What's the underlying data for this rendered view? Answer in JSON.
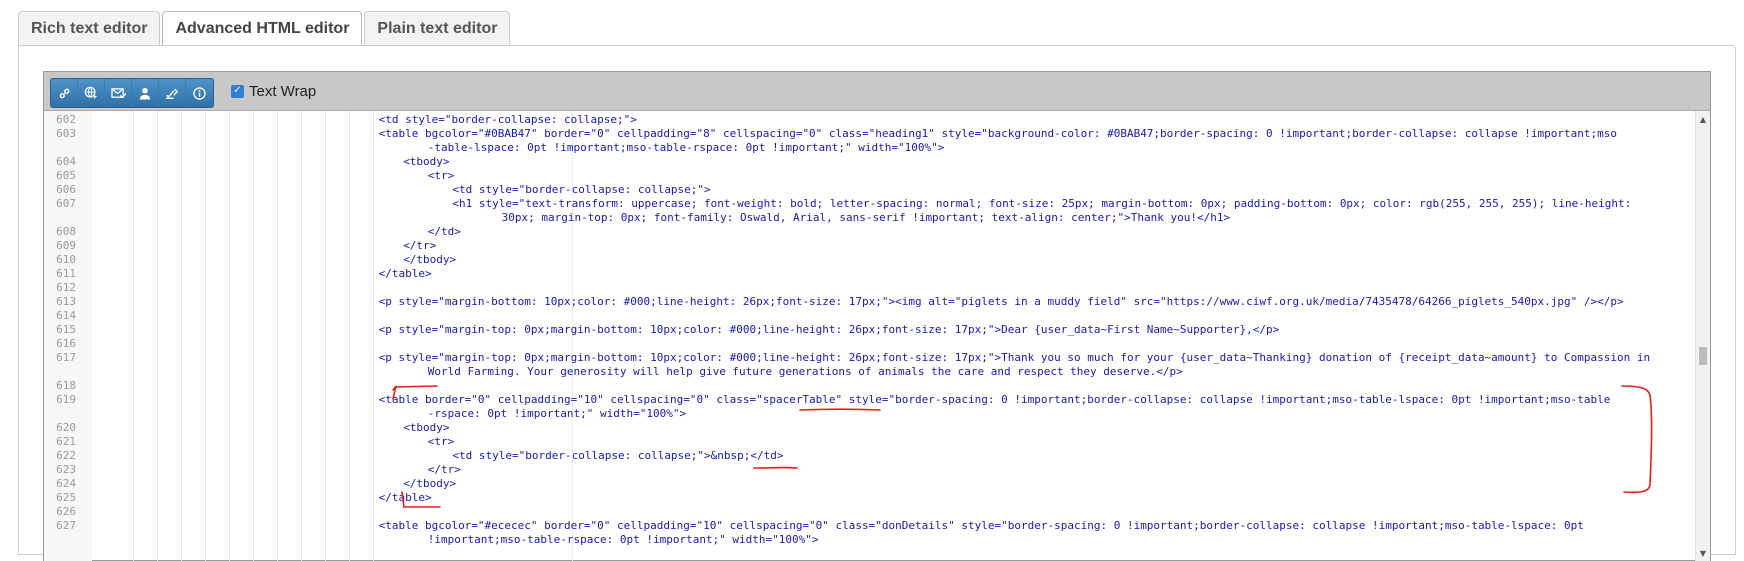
{
  "tabs": [
    {
      "label": "Rich text editor",
      "active": false
    },
    {
      "label": "Advanced HTML editor",
      "active": true
    },
    {
      "label": "Plain text editor",
      "active": false
    }
  ],
  "toolbar": {
    "buttons": [
      {
        "icon": "link-icon"
      },
      {
        "icon": "globe-icon"
      },
      {
        "icon": "envelope-icon"
      },
      {
        "icon": "user-icon"
      },
      {
        "icon": "checklist-icon"
      },
      {
        "icon": "info-icon"
      }
    ],
    "text_wrap_label": "Text Wrap",
    "text_wrap_checked": true
  },
  "code_lines": [
    {
      "n": "602",
      "indent": 11,
      "text": "<td style=\"border-collapse: collapse;\">"
    },
    {
      "n": "603",
      "indent": 11,
      "text": "<table bgcolor=\"#0BAB47\" border=\"0\" cellpadding=\"8\" cellspacing=\"0\" class=\"heading1\" style=\"background-color: #0BAB47;border-spacing: 0 !important;border-collapse: collapse !important;mso"
    },
    {
      "n": "",
      "indent": 13,
      "text": "-table-lspace: 0pt !important;mso-table-rspace: 0pt !important;\" width=\"100%\">"
    },
    {
      "n": "604",
      "indent": 12,
      "text": "<tbody>"
    },
    {
      "n": "605",
      "indent": 13,
      "text": "<tr>"
    },
    {
      "n": "606",
      "indent": 14,
      "text": "<td style=\"border-collapse: collapse;\">"
    },
    {
      "n": "607",
      "indent": 14,
      "text": "<h1 style=\"text-transform: uppercase; font-weight: bold; letter-spacing: normal; font-size: 25px; margin-bottom: 0px; padding-bottom: 0px; color: rgb(255, 255, 255); line-height:"
    },
    {
      "n": "",
      "indent": 16,
      "text": "30px; margin-top: 0px; font-family: Oswald, Arial, sans-serif !important; text-align: center;\">Thank you!</h1>"
    },
    {
      "n": "608",
      "indent": 13,
      "text": "</td>"
    },
    {
      "n": "609",
      "indent": 12,
      "text": "</tr>"
    },
    {
      "n": "610",
      "indent": 12,
      "text": "</tbody>"
    },
    {
      "n": "611",
      "indent": 11,
      "text": "</table>"
    },
    {
      "n": "612",
      "indent": 11,
      "text": ""
    },
    {
      "n": "613",
      "indent": 11,
      "text": "<p style=\"margin-bottom: 10px;color: #000;line-height: 26px;font-size: 17px;\"><img alt=\"piglets in a muddy field\" src=\"https://www.ciwf.org.uk/media/7435478/64266_piglets_540px.jpg\" /></p>"
    },
    {
      "n": "614",
      "indent": 11,
      "text": ""
    },
    {
      "n": "615",
      "indent": 11,
      "text": "<p style=\"margin-top: 0px;margin-bottom: 10px;color: #000;line-height: 26px;font-size: 17px;\">Dear {user_data~First Name~Supporter},</p>"
    },
    {
      "n": "616",
      "indent": 11,
      "text": ""
    },
    {
      "n": "617",
      "indent": 11,
      "text": "<p style=\"margin-top: 0px;margin-bottom: 10px;color: #000;line-height: 26px;font-size: 17px;\">Thank you so much for your {user_data~Thanking} donation of {receipt_data~amount} to Compassion in"
    },
    {
      "n": "",
      "indent": 13,
      "text": "World Farming. Your generosity will help give future generations of animals the care and respect they deserve.</p>"
    },
    {
      "n": "618",
      "indent": 11,
      "text": ""
    },
    {
      "n": "619",
      "indent": 11,
      "text": "<table border=\"0\" cellpadding=\"10\" cellspacing=\"0\" class=\"spacerTable\" style=\"border-spacing: 0 !important;border-collapse: collapse !important;mso-table-lspace: 0pt !important;mso-table"
    },
    {
      "n": "",
      "indent": 13,
      "text": "-rspace: 0pt !important;\" width=\"100%\">"
    },
    {
      "n": "620",
      "indent": 12,
      "text": "<tbody>"
    },
    {
      "n": "621",
      "indent": 13,
      "text": "<tr>"
    },
    {
      "n": "622",
      "indent": 14,
      "text": "<td style=\"border-collapse: collapse;\">&nbsp;</td>"
    },
    {
      "n": "623",
      "indent": 13,
      "text": "</tr>"
    },
    {
      "n": "624",
      "indent": 12,
      "text": "</tbody>"
    },
    {
      "n": "625",
      "indent": 11,
      "text": "</table>"
    },
    {
      "n": "626",
      "indent": 11,
      "text": ""
    },
    {
      "n": "627",
      "indent": 11,
      "text": "<table bgcolor=\"#ececec\" border=\"0\" cellpadding=\"10\" cellspacing=\"0\" class=\"donDetails\" style=\"border-spacing: 0 !important;border-collapse: collapse !important;mso-table-lspace: 0pt"
    },
    {
      "n": "",
      "indent": 13,
      "text": "!important;mso-table-rspace: 0pt !important;\" width=\"100%\">"
    }
  ],
  "colors": {
    "toolbar_bg": "#c8c8c8",
    "button_blue": "#2f71a6",
    "code_text": "#1a1aa6",
    "annotation_red": "#e02020"
  }
}
